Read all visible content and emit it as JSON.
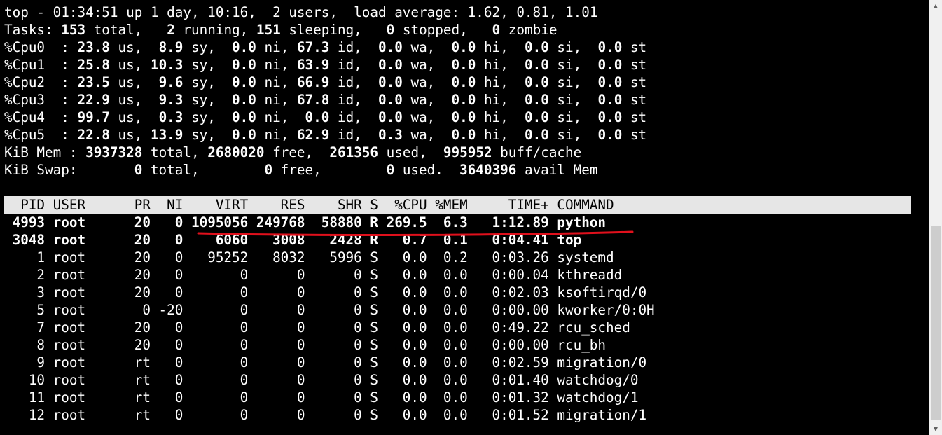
{
  "summary": {
    "uptime_line": "top - 01:34:51 up 1 day, 10:16,  2 users,  load average: 1.62, 0.81, 1.01",
    "tasks": {
      "label": "Tasks:",
      "total": "153",
      "total_label": " total,   ",
      "running": "2",
      "running_label": " running, ",
      "sleeping": "151",
      "sleeping_label": " sleeping,   ",
      "stopped": "0",
      "stopped_label": " stopped,   ",
      "zombie": "0",
      "zombie_label": " zombie"
    },
    "cpus": [
      {
        "label": "%Cpu0  : ",
        "us": "23.8",
        "sy": " 8.9",
        "ni": " 0.0",
        "id": "67.3",
        "wa": " 0.0",
        "hi": " 0.0",
        "si": " 0.0",
        "st": " 0.0"
      },
      {
        "label": "%Cpu1  : ",
        "us": "25.8",
        "sy": "10.3",
        "ni": " 0.0",
        "id": "63.9",
        "wa": " 0.0",
        "hi": " 0.0",
        "si": " 0.0",
        "st": " 0.0"
      },
      {
        "label": "%Cpu2  : ",
        "us": "23.5",
        "sy": " 9.6",
        "ni": " 0.0",
        "id": "66.9",
        "wa": " 0.0",
        "hi": " 0.0",
        "si": " 0.0",
        "st": " 0.0"
      },
      {
        "label": "%Cpu3  : ",
        "us": "22.9",
        "sy": " 9.3",
        "ni": " 0.0",
        "id": "67.8",
        "wa": " 0.0",
        "hi": " 0.0",
        "si": " 0.0",
        "st": " 0.0"
      },
      {
        "label": "%Cpu4  : ",
        "us": "99.7",
        "sy": " 0.3",
        "ni": " 0.0",
        "id": " 0.0",
        "wa": " 0.0",
        "hi": " 0.0",
        "si": " 0.0",
        "st": " 0.0"
      },
      {
        "label": "%Cpu5  : ",
        "us": "22.8",
        "sy": "13.9",
        "ni": " 0.0",
        "id": "62.9",
        "wa": " 0.3",
        "hi": " 0.0",
        "si": " 0.0",
        "st": " 0.0"
      }
    ],
    "cpu_field_labels": [
      " us, ",
      " sy, ",
      " ni, ",
      " id, ",
      " wa, ",
      " hi, ",
      " si, ",
      " st"
    ],
    "mem": {
      "label": "KiB Mem : ",
      "total": "3937328",
      "total_label": " total, ",
      "free": "2680020",
      "free_label": " free,  ",
      "used": "261356",
      "used_label": " used,  ",
      "buff": "995952",
      "buff_label": " buff/cache"
    },
    "swap": {
      "label": "KiB Swap:       ",
      "total": "0",
      "total_label": " total,        ",
      "free": "0",
      "free_label": " free,        ",
      "used": "0",
      "used_label": " used.  ",
      "avail": "3640396",
      "avail_label": " avail Mem"
    }
  },
  "process_table": {
    "header": "  PID USER      PR  NI    VIRT    RES    SHR S  %CPU %MEM     TIME+ COMMAND",
    "rows": [
      {
        "text": " 4993 root      20   0 1095056 249768  58880 R 269.5  6.3   1:12.89 python",
        "bold": true
      },
      {
        "text": " 3048 root      20   0    6060   3008   2428 R   0.7  0.1   0:04.41 top",
        "bold": true
      },
      {
        "text": "    1 root      20   0   95252   8032   5996 S   0.0  0.2   0:03.26 systemd",
        "bold": false
      },
      {
        "text": "    2 root      20   0       0      0      0 S   0.0  0.0   0:00.04 kthreadd",
        "bold": false
      },
      {
        "text": "    3 root      20   0       0      0      0 S   0.0  0.0   0:02.03 ksoftirqd/0",
        "bold": false
      },
      {
        "text": "    5 root       0 -20       0      0      0 S   0.0  0.0   0:00.00 kworker/0:0H",
        "bold": false
      },
      {
        "text": "    7 root      20   0       0      0      0 S   0.0  0.0   0:49.22 rcu_sched",
        "bold": false
      },
      {
        "text": "    8 root      20   0       0      0      0 S   0.0  0.0   0:00.00 rcu_bh",
        "bold": false
      },
      {
        "text": "    9 root      rt   0       0      0      0 S   0.0  0.0   0:02.59 migration/0",
        "bold": false
      },
      {
        "text": "   10 root      rt   0       0      0      0 S   0.0  0.0   0:01.40 watchdog/0",
        "bold": false
      },
      {
        "text": "   11 root      rt   0       0      0      0 S   0.0  0.0   0:01.32 watchdog/1",
        "bold": false
      },
      {
        "text": "   12 root      rt   0       0      0      0 S   0.0  0.0   0:01.52 migration/1",
        "bold": false
      }
    ]
  },
  "colors": {
    "background": "#000000",
    "text": "#ffffff",
    "header_bg": "#e6e6e6",
    "header_text": "#000000",
    "annotation": "#e0101c"
  },
  "scrollbar": {
    "up_icon": "triangle-up-icon",
    "down_icon": "triangle-down-icon"
  }
}
